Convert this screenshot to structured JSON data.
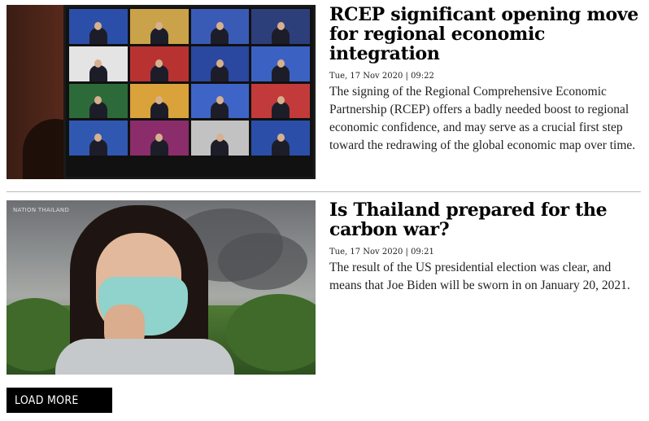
{
  "articles": [
    {
      "headline": "RCEP significant opening move for regional economic integration",
      "dateline": "Tue, 17 Nov 2020 | 09:22",
      "summary": "The signing of the Regional Comprehensive Economic Partnership (RCEP) offers a badly needed boost to regional economic confidence, and may serve as a crucial first step toward the redrawing of the global economic map over time."
    },
    {
      "headline": "Is Thailand prepared for the carbon war?",
      "dateline": "Tue, 17 Nov 2020 | 09:21",
      "summary": "The result of the US presidential election was clear, and means that Joe Biden will be sworn in on January 20, 2021.",
      "image_watermark": "NATION THAILAND"
    }
  ],
  "load_more_label": "LOAD MORE",
  "colors": {
    "button_bg": "#000000",
    "button_text": "#ffffff",
    "divider": "#bcbcbc",
    "mask": "#8fd3cc"
  }
}
